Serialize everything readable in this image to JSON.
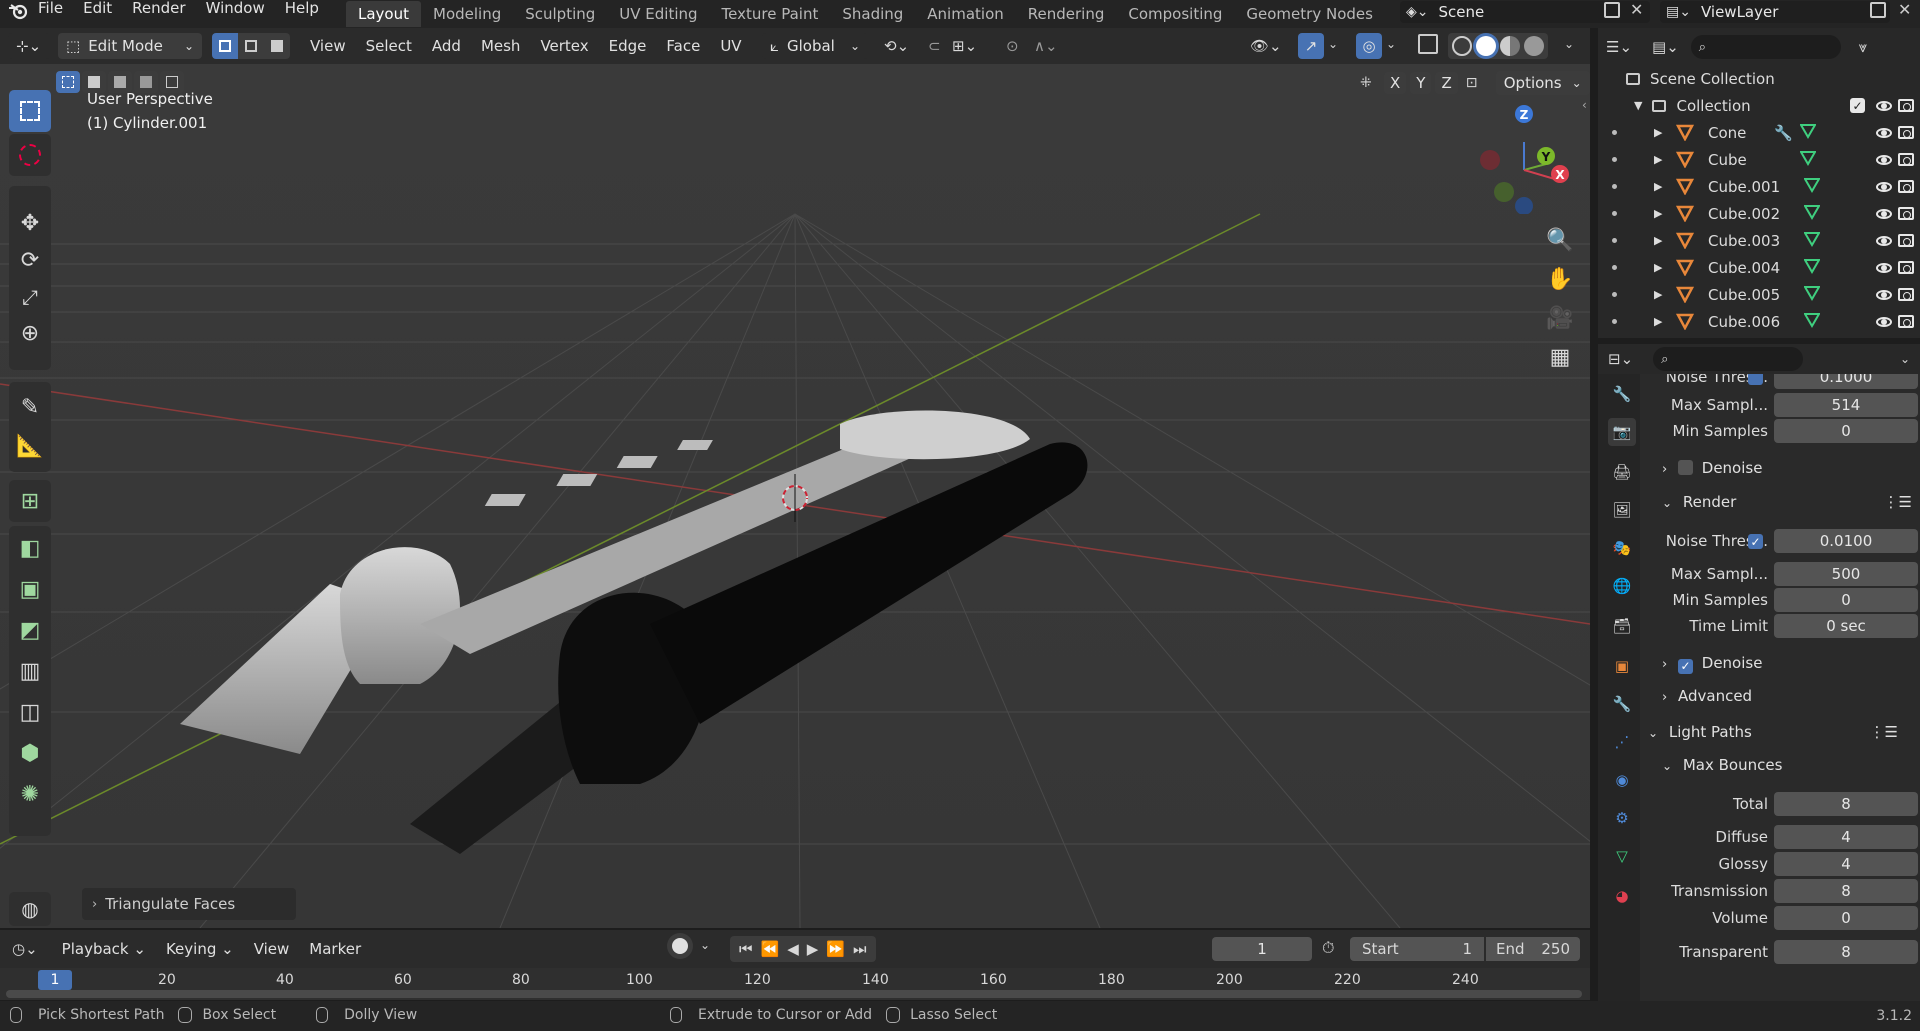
{
  "topbar": {
    "menus": [
      "File",
      "Edit",
      "Render",
      "Window",
      "Help"
    ],
    "workspaces": [
      "Layout",
      "Modeling",
      "Sculpting",
      "UV Editing",
      "Texture Paint",
      "Shading",
      "Animation",
      "Rendering",
      "Compositing",
      "Geometry Nodes"
    ],
    "active_workspace": "Layout",
    "scene": "Scene",
    "view_layer": "ViewLayer"
  },
  "header": {
    "mode": "Edit Mode",
    "menus": [
      "View",
      "Select",
      "Add",
      "Mesh",
      "Vertex",
      "Edge",
      "Face",
      "UV"
    ],
    "orientation": "Global",
    "options_label": "Options",
    "axes": [
      "X",
      "Y",
      "Z"
    ]
  },
  "viewport": {
    "perspective": "User Perspective",
    "object": "(1) Cylinder.001",
    "operator_panel": "Triangulate Faces",
    "gizmo": {
      "z": "Z",
      "y": "Y",
      "x": "X"
    }
  },
  "outliner": {
    "scene_collection": "Scene Collection",
    "collection": "Collection",
    "items": [
      "Cone",
      "Cube",
      "Cube.001",
      "Cube.002",
      "Cube.003",
      "Cube.004",
      "Cube.005",
      "Cube.006"
    ]
  },
  "properties": {
    "top_partial_label": "Noise Thres...",
    "top_partial_value": "0.1000",
    "viewport_max_samples_label": "Max Sampl...",
    "viewport_max_samples": "514",
    "viewport_min_samples_label": "Min Samples",
    "viewport_min_samples": "0",
    "denoise_label": "Denoise",
    "render_section": "Render",
    "noise_threshold_label": "Noise Thres...",
    "noise_threshold": "0.0100",
    "max_samples_label": "Max Sampl...",
    "max_samples": "500",
    "min_samples_label": "Min Samples",
    "min_samples": "0",
    "time_limit_label": "Time Limit",
    "time_limit": "0 sec",
    "render_denoise_label": "Denoise",
    "advanced_label": "Advanced",
    "light_paths_label": "Light Paths",
    "max_bounces_label": "Max Bounces",
    "bounces": [
      {
        "label": "Total",
        "value": "8"
      },
      {
        "label": "Diffuse",
        "value": "4"
      },
      {
        "label": "Glossy",
        "value": "4"
      },
      {
        "label": "Transmission",
        "value": "8"
      },
      {
        "label": "Volume",
        "value": "0"
      },
      {
        "label": "Transparent",
        "value": "8"
      }
    ]
  },
  "timeline": {
    "menus": [
      "Playback",
      "Keying",
      "View",
      "Marker"
    ],
    "current_frame": "1",
    "start_label": "Start",
    "start": "1",
    "end_label": "End",
    "end": "250",
    "ruler": [
      "1",
      "20",
      "40",
      "60",
      "80",
      "100",
      "120",
      "140",
      "160",
      "180",
      "200",
      "220",
      "240"
    ]
  },
  "statusbar": {
    "hints": [
      "Pick Shortest Path",
      "Box Select",
      "Dolly View",
      "Extrude to Cursor or Add",
      "Lasso Select"
    ],
    "version": "3.1.2"
  },
  "colors": {
    "accent": "#4772b3",
    "panel": "#2a2a2a",
    "viewport": "#393939",
    "orange": "#e8873a"
  }
}
